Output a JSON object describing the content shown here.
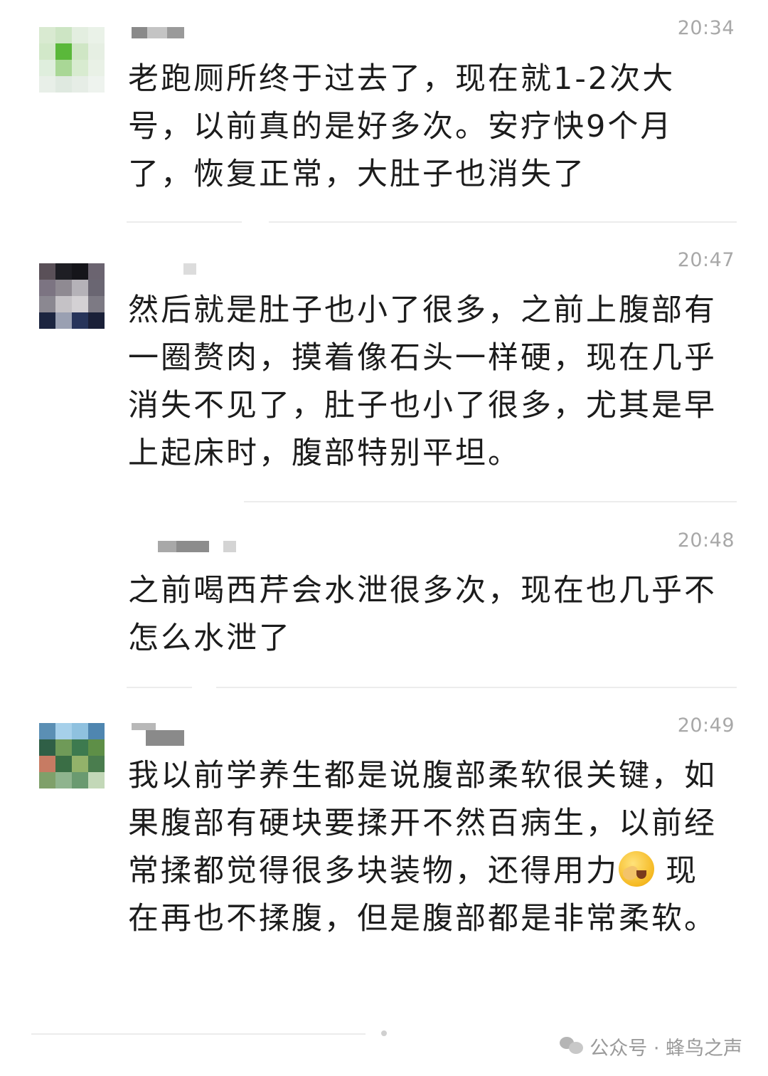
{
  "messages": [
    {
      "time": "20:34",
      "text": "老跑厕所终于过去了，现在就1-2次大号，以前真的是好多次。安疗快9个月了，恢复正常，大肚子也消失了"
    },
    {
      "time": "20:47",
      "text": "然后就是肚子也小了很多，之前上腹部有一圈赘肉，摸着像石头一样硬，现在几乎消失不见了，肚子也小了很多，尤其是早上起床时，腹部特别平坦。"
    },
    {
      "time": "20:48",
      "text": "之前喝西芹会水泄很多次，现在也几乎不怎么水泄了"
    },
    {
      "time": "20:49",
      "text_before": "我以前学养生都是说腹部柔软很关键，如果腹部有硬块要揉开不然百病生，以前经常揉都觉得很多块装物，还得用力",
      "emoji": "facepalm-emoji",
      "text_after": "现在再也不揉腹，但是腹部都是非常柔软。"
    }
  ],
  "watermark": {
    "icon": "wechat-icon",
    "text": "公众号 · 蜂鸟之声"
  }
}
